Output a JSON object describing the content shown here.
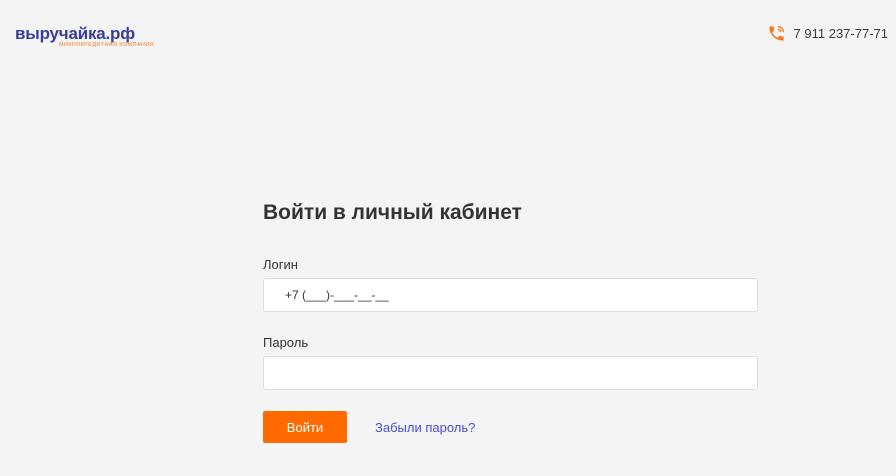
{
  "header": {
    "logo": {
      "word": "выручайка.рф",
      "subtitle": "микрокредитная компания"
    },
    "phone": {
      "icon": "phone-icon",
      "number": "7 911 237-77-71"
    }
  },
  "login_form": {
    "title": "Войти в личный кабинет",
    "login_label": "Логин",
    "login_value": "+7 (___)-___-__-__",
    "password_label": "Пароль",
    "password_value": "",
    "submit_label": "Войти",
    "forgot_label": "Забыли пароль?"
  },
  "colors": {
    "accent": "#ff6b00",
    "brand_blue": "#3b3d9a",
    "link": "#4b4bd8",
    "background": "#f4f4f4"
  }
}
